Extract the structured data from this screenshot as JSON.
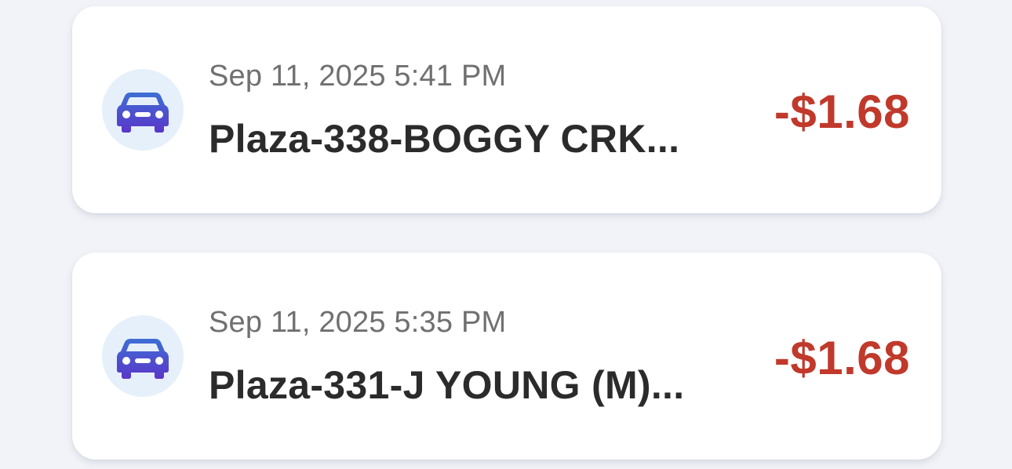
{
  "transactions": [
    {
      "date": "Sep 11, 2025 5:41 PM",
      "name": "Plaza-338-BOGGY CRK...",
      "amount": "-$1.68",
      "icon": "car-icon"
    },
    {
      "date": "Sep 11, 2025 5:35 PM",
      "name": "Plaza-331-J YOUNG (M)...",
      "amount": "-$1.68",
      "icon": "car-icon"
    }
  ],
  "colors": {
    "amount_negative": "#c0392b",
    "icon_bg": "#e6f0fb",
    "icon_gradient_top": "#3d6fd4",
    "icon_gradient_bottom": "#5b36c9",
    "page_bg": "#f1f3f8"
  }
}
